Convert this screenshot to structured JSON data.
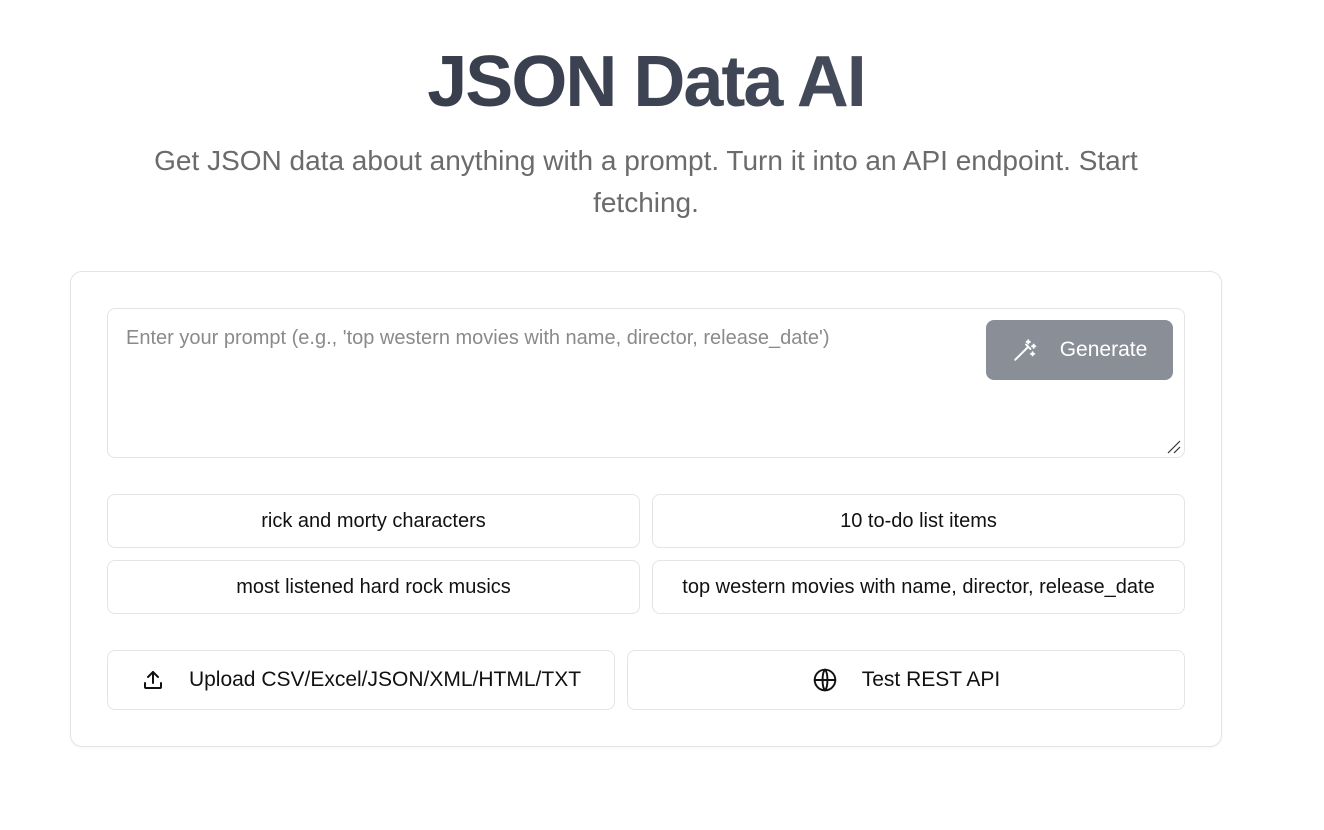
{
  "header": {
    "title": "JSON Data AI",
    "subtitle": "Get JSON data about anything with a prompt. Turn it into an API endpoint. Start fetching."
  },
  "prompt": {
    "placeholder": "Enter your prompt (e.g., 'top western movies with name, director, release_date')",
    "value": "",
    "generate_label": "Generate",
    "generate_icon": "magic-wand-icon"
  },
  "examples": [
    "rick and morty characters",
    "10 to-do list items",
    "most listened hard rock musics",
    "top western movies with name, director, release_date"
  ],
  "actions": {
    "upload_label": "Upload CSV/Excel/JSON/XML/HTML/TXT",
    "upload_icon": "upload-icon",
    "test_api_label": "Test REST API",
    "test_api_icon": "globe-icon"
  }
}
